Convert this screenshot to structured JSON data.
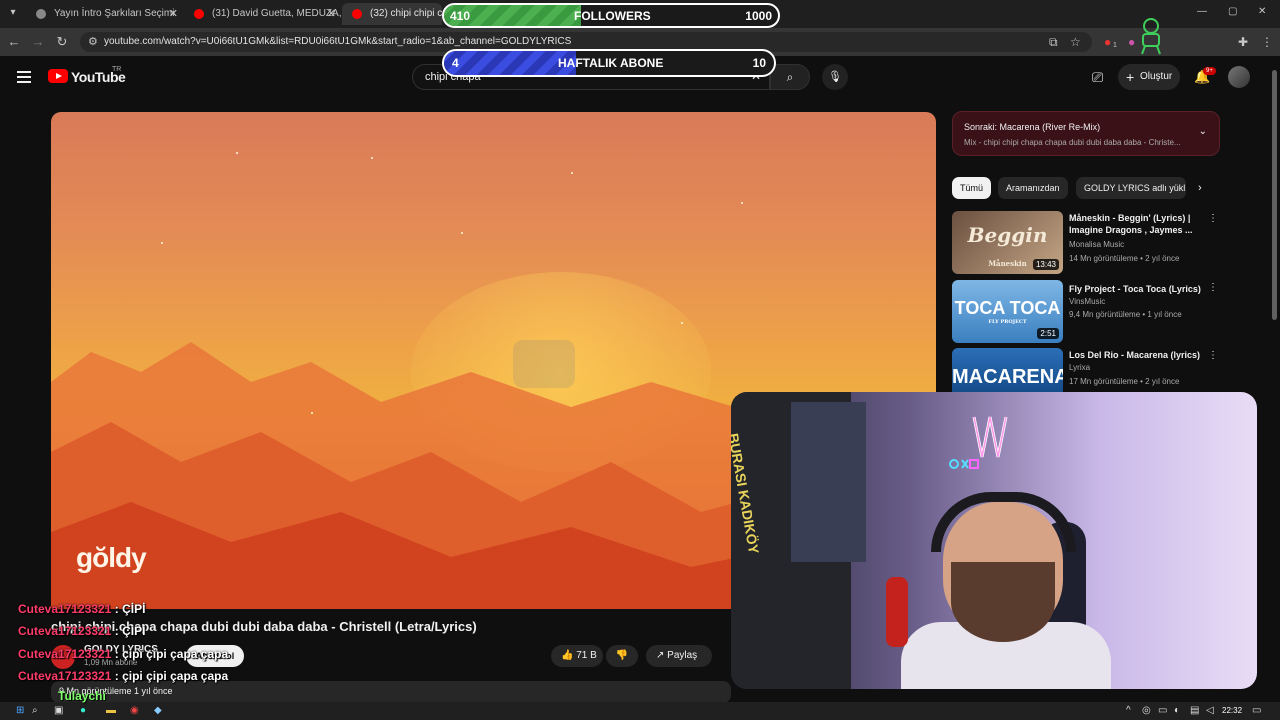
{
  "browser": {
    "tabs": [
      {
        "title": "Yayın İntro Şarkıları Seçimi"
      },
      {
        "title": "(31) David Guetta, MEDUZA, Ja"
      },
      {
        "title": "(32) chipi chipi chapa"
      }
    ],
    "url": "youtube.com/watch?v=U0i66tU1GMk&list=RDU0i66tU1GMk&start_radio=1&ab_channel=GOLDYLYRICS",
    "extension_badge": "1"
  },
  "header": {
    "logo_text": "YouTube",
    "country": "TR",
    "search_query": "chipi chapa",
    "create_label": "Oluştur",
    "notif_count": "9+"
  },
  "counters": {
    "followers": {
      "current": "410",
      "label": "FOLLOWERS",
      "goal": "1000",
      "progress": 0.41
    },
    "weekly": {
      "current": "4",
      "label": "HAFTALIK ABONE",
      "goal": "10",
      "progress": 0.4
    }
  },
  "video": {
    "watermark": "gŏldy",
    "title": "chipi chipi chapa chapa dubi dubi daba daba - Christell (Letra/Lyrics)",
    "channel": "GOLDY LYRICS",
    "subs": "1,09 Mn abone",
    "subscribe_label": "Abone ol",
    "likes": "71 B",
    "share_label": "Paylaş",
    "views_meta": "9 Mn görüntüleme  1 yıl önce"
  },
  "sidebar": {
    "next_label": "Sonraki:",
    "next_title": "Macarena (River Re-Mix)",
    "mix_title": "Mix - chipi chipi chapa chapa dubi dubi daba daba - Christe...",
    "chips": [
      "Tümü",
      "Aramanızdan",
      "GOLDY LYRICS adlı yükl"
    ],
    "recommendations": [
      {
        "thumb_text": "Beggin",
        "thumb_sub": "Måneskin",
        "duration": "13:43",
        "title": "Måneskin - Beggin' (Lyrics) | Imagine Dragons , Jaymes ...",
        "channel": "Monalisa Music",
        "meta": "14 Mn görüntüleme • 2 yıl önce"
      },
      {
        "thumb_text": "TOCA TOCA",
        "thumb_sub": "FLY PROJECT",
        "duration": "2:51",
        "title": "Fly Project - Toca Toca (Lyrics)",
        "channel": "VinsMusic",
        "meta": "9,4 Mn görüntüleme • 1 yıl önce"
      },
      {
        "thumb_text": "MACARENA",
        "thumb_sub": "",
        "duration": "",
        "title": "Los Del Rio - Macarena (lyrics)",
        "channel": "Lyrixa",
        "meta": "17 Mn görüntüleme • 2 yıl önce"
      }
    ]
  },
  "webcam": {
    "jersey_text": "BURASI KADIKÖY"
  },
  "chat": [
    {
      "user": "Cuteva17123321",
      "sep": " : ",
      "msg": "ÇİPİ"
    },
    {
      "user": "Cuteva17123321",
      "sep": " : ",
      "msg": "ÇİPİ"
    },
    {
      "user": "Cuteva17123321",
      "sep": " : ",
      "msg": "çipi çipi çapa çapa"
    },
    {
      "user": "Cuteva17123321",
      "sep": " : ",
      "msg": "çipi çipi çapa çapa"
    }
  ],
  "taskbar": {
    "viewer": "Tulaychi",
    "time": "22:32"
  }
}
